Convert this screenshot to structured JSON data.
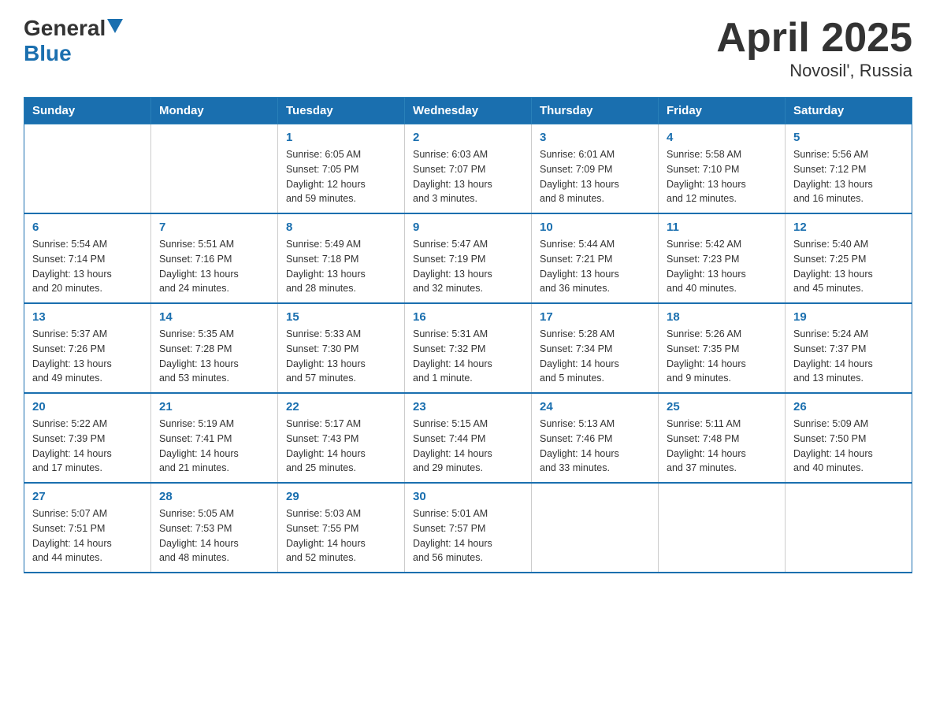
{
  "header": {
    "logo_general": "General",
    "logo_blue": "Blue",
    "title": "April 2025",
    "subtitle": "Novosil', Russia"
  },
  "days_of_week": [
    "Sunday",
    "Monday",
    "Tuesday",
    "Wednesday",
    "Thursday",
    "Friday",
    "Saturday"
  ],
  "weeks": [
    [
      {
        "day": "",
        "info": ""
      },
      {
        "day": "",
        "info": ""
      },
      {
        "day": "1",
        "info": "Sunrise: 6:05 AM\nSunset: 7:05 PM\nDaylight: 12 hours\nand 59 minutes."
      },
      {
        "day": "2",
        "info": "Sunrise: 6:03 AM\nSunset: 7:07 PM\nDaylight: 13 hours\nand 3 minutes."
      },
      {
        "day": "3",
        "info": "Sunrise: 6:01 AM\nSunset: 7:09 PM\nDaylight: 13 hours\nand 8 minutes."
      },
      {
        "day": "4",
        "info": "Sunrise: 5:58 AM\nSunset: 7:10 PM\nDaylight: 13 hours\nand 12 minutes."
      },
      {
        "day": "5",
        "info": "Sunrise: 5:56 AM\nSunset: 7:12 PM\nDaylight: 13 hours\nand 16 minutes."
      }
    ],
    [
      {
        "day": "6",
        "info": "Sunrise: 5:54 AM\nSunset: 7:14 PM\nDaylight: 13 hours\nand 20 minutes."
      },
      {
        "day": "7",
        "info": "Sunrise: 5:51 AM\nSunset: 7:16 PM\nDaylight: 13 hours\nand 24 minutes."
      },
      {
        "day": "8",
        "info": "Sunrise: 5:49 AM\nSunset: 7:18 PM\nDaylight: 13 hours\nand 28 minutes."
      },
      {
        "day": "9",
        "info": "Sunrise: 5:47 AM\nSunset: 7:19 PM\nDaylight: 13 hours\nand 32 minutes."
      },
      {
        "day": "10",
        "info": "Sunrise: 5:44 AM\nSunset: 7:21 PM\nDaylight: 13 hours\nand 36 minutes."
      },
      {
        "day": "11",
        "info": "Sunrise: 5:42 AM\nSunset: 7:23 PM\nDaylight: 13 hours\nand 40 minutes."
      },
      {
        "day": "12",
        "info": "Sunrise: 5:40 AM\nSunset: 7:25 PM\nDaylight: 13 hours\nand 45 minutes."
      }
    ],
    [
      {
        "day": "13",
        "info": "Sunrise: 5:37 AM\nSunset: 7:26 PM\nDaylight: 13 hours\nand 49 minutes."
      },
      {
        "day": "14",
        "info": "Sunrise: 5:35 AM\nSunset: 7:28 PM\nDaylight: 13 hours\nand 53 minutes."
      },
      {
        "day": "15",
        "info": "Sunrise: 5:33 AM\nSunset: 7:30 PM\nDaylight: 13 hours\nand 57 minutes."
      },
      {
        "day": "16",
        "info": "Sunrise: 5:31 AM\nSunset: 7:32 PM\nDaylight: 14 hours\nand 1 minute."
      },
      {
        "day": "17",
        "info": "Sunrise: 5:28 AM\nSunset: 7:34 PM\nDaylight: 14 hours\nand 5 minutes."
      },
      {
        "day": "18",
        "info": "Sunrise: 5:26 AM\nSunset: 7:35 PM\nDaylight: 14 hours\nand 9 minutes."
      },
      {
        "day": "19",
        "info": "Sunrise: 5:24 AM\nSunset: 7:37 PM\nDaylight: 14 hours\nand 13 minutes."
      }
    ],
    [
      {
        "day": "20",
        "info": "Sunrise: 5:22 AM\nSunset: 7:39 PM\nDaylight: 14 hours\nand 17 minutes."
      },
      {
        "day": "21",
        "info": "Sunrise: 5:19 AM\nSunset: 7:41 PM\nDaylight: 14 hours\nand 21 minutes."
      },
      {
        "day": "22",
        "info": "Sunrise: 5:17 AM\nSunset: 7:43 PM\nDaylight: 14 hours\nand 25 minutes."
      },
      {
        "day": "23",
        "info": "Sunrise: 5:15 AM\nSunset: 7:44 PM\nDaylight: 14 hours\nand 29 minutes."
      },
      {
        "day": "24",
        "info": "Sunrise: 5:13 AM\nSunset: 7:46 PM\nDaylight: 14 hours\nand 33 minutes."
      },
      {
        "day": "25",
        "info": "Sunrise: 5:11 AM\nSunset: 7:48 PM\nDaylight: 14 hours\nand 37 minutes."
      },
      {
        "day": "26",
        "info": "Sunrise: 5:09 AM\nSunset: 7:50 PM\nDaylight: 14 hours\nand 40 minutes."
      }
    ],
    [
      {
        "day": "27",
        "info": "Sunrise: 5:07 AM\nSunset: 7:51 PM\nDaylight: 14 hours\nand 44 minutes."
      },
      {
        "day": "28",
        "info": "Sunrise: 5:05 AM\nSunset: 7:53 PM\nDaylight: 14 hours\nand 48 minutes."
      },
      {
        "day": "29",
        "info": "Sunrise: 5:03 AM\nSunset: 7:55 PM\nDaylight: 14 hours\nand 52 minutes."
      },
      {
        "day": "30",
        "info": "Sunrise: 5:01 AM\nSunset: 7:57 PM\nDaylight: 14 hours\nand 56 minutes."
      },
      {
        "day": "",
        "info": ""
      },
      {
        "day": "",
        "info": ""
      },
      {
        "day": "",
        "info": ""
      }
    ]
  ]
}
